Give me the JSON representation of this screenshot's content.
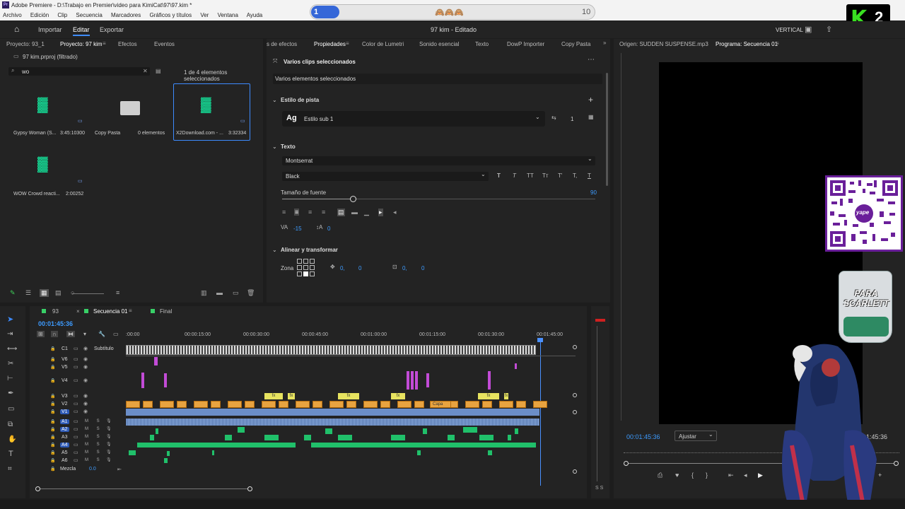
{
  "app": {
    "title": "Adobe Premiere - D:\\Trabajo en Premier\\video para KimiCat\\97\\97.kim *"
  },
  "menu": [
    "Archivo",
    "Edición",
    "Clip",
    "Secuencia",
    "Marcadores",
    "Gráficos y títulos",
    "Ver",
    "Ventana",
    "Ayuda"
  ],
  "header": {
    "tabs": [
      "Importar",
      "Editar",
      "Exportar"
    ],
    "center": "97 kim - Editado",
    "layout": "VERTICAL"
  },
  "progress": {
    "start": "1",
    "end": "10",
    "emojis": "🙈🙈🙈",
    "fraction": 0.08
  },
  "overlay": {
    "k_badge": "2",
    "cup_text": "PARA SCARLETT"
  },
  "project": {
    "tabs": [
      "Proyecto: 93_1",
      "Proyecto: 97 kim",
      "Efectos",
      "Eventos"
    ],
    "file": "97 kim.prproj (filtrado)",
    "search": "wo",
    "selection": "1 de 4 elementos seleccionados",
    "items": [
      {
        "name": "Gypsy Woman (S...",
        "dur": "3:45:10300"
      },
      {
        "name": "Copy Pasta",
        "dur": "0 elementos"
      },
      {
        "name": "X2Download.com - ...",
        "dur": "3:32334"
      },
      {
        "name": "WOW  Crowd reacti...",
        "dur": "2:00252"
      }
    ]
  },
  "props": {
    "tabs": [
      "s de efectos",
      "Propiedades",
      "Color de Lumetri",
      "Sonido esencial",
      "Texto",
      "DowP Importer",
      "Copy Pasta"
    ],
    "heading": "Varios clips seleccionados",
    "field": "Varios elementos seleccionados",
    "track_style_label": "Estilo de pista",
    "style_name": "Estilo sub 1",
    "style_count": "1",
    "text_label": "Texto",
    "font": "Montserrat",
    "weight": "Black",
    "size_label": "Tamaño de fuente",
    "size_value": "90",
    "tracking": "-15",
    "leading": "0",
    "align_label": "Alinear y transformar",
    "zone_label": "Zona",
    "pos_x": "0,",
    "pos_y": "0",
    "anchor_x": "0,",
    "anchor_y": "0"
  },
  "monitor": {
    "source": "Origen: SUDDEN SUSPENSE.mp3",
    "program": "Programa: Secuencia 01",
    "timecode": "00:01:45:36",
    "fit": "Ajustar",
    "duration": "01:45:36"
  },
  "timeline": {
    "tabs": [
      "93",
      "Secuencia 01",
      "Final"
    ],
    "timecode": "00:01:45:36",
    "ruler": [
      ":00:00",
      "00:00:15:00",
      "00:00:30:00",
      "00:00:45:00",
      "00:01:00:00",
      "00:01:15:00",
      "00:01:30:00",
      "00:01:45:00"
    ],
    "tracks": [
      {
        "id": "C1",
        "name": "Subtítulo"
      },
      {
        "id": "V6"
      },
      {
        "id": "V5"
      },
      {
        "id": "V4"
      },
      {
        "id": "V3"
      },
      {
        "id": "V2"
      },
      {
        "id": "V1"
      },
      {
        "id": "A1"
      },
      {
        "id": "A2"
      },
      {
        "id": "A3"
      },
      {
        "id": "A4"
      },
      {
        "id": "A5"
      },
      {
        "id": "A6"
      }
    ],
    "mix": "Mezcla",
    "mix_value": "0.0",
    "clip_text": "Capa",
    "fx": "fx",
    "track_ms": "M S",
    "meter_label": "S S"
  }
}
